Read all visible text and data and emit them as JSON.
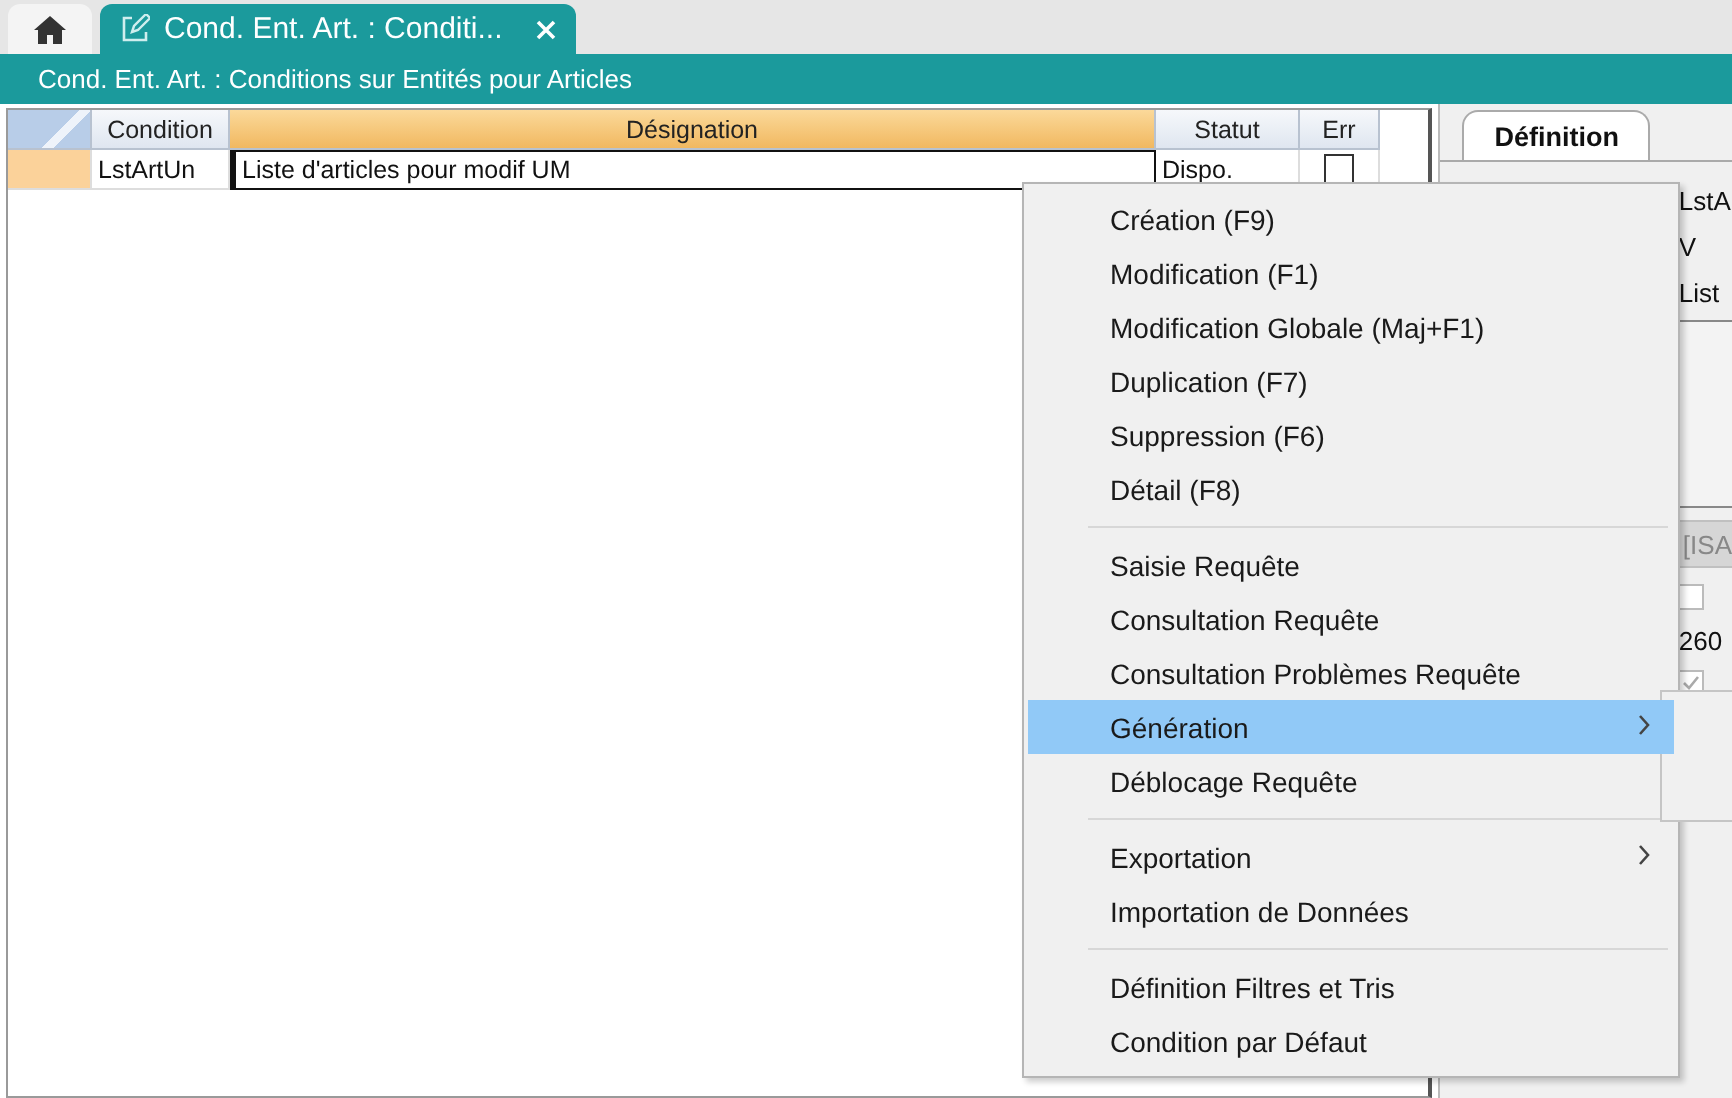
{
  "tabs": [
    {
      "kind": "home",
      "selected": false
    },
    {
      "kind": "document",
      "label": "Cond. Ent. Art. : Conditi...",
      "selected": true
    }
  ],
  "title_bar": {
    "title": "Cond. Ent. Art. : Conditions sur Entités pour Articles"
  },
  "grid": {
    "columns": [
      "Condition",
      "Désignation",
      "Statut",
      "Err"
    ],
    "rows": [
      {
        "selected": true,
        "condition": "LstArtUn",
        "designation": "Liste d'articles pour modif UM",
        "statut": "Dispo.",
        "err": false
      }
    ]
  },
  "side_panel": {
    "tab": "Définition",
    "code": "LstA",
    "version": "V",
    "label": "List",
    "field": "[ISA",
    "check_1": false,
    "number": "260",
    "check_2": true
  },
  "context_menu": {
    "items": [
      {
        "kind": "item",
        "label": "Création (F9)",
        "selected": false,
        "submenu": false
      },
      {
        "kind": "item",
        "label": "Modification (F1)",
        "selected": false,
        "submenu": false
      },
      {
        "kind": "item",
        "label": "Modification Globale (Maj+F1)",
        "selected": false,
        "submenu": false
      },
      {
        "kind": "item",
        "label": "Duplication (F7)",
        "selected": false,
        "submenu": false
      },
      {
        "kind": "item",
        "label": "Suppression (F6)",
        "selected": false,
        "submenu": false
      },
      {
        "kind": "item",
        "label": "Détail (F8)",
        "selected": false,
        "submenu": false
      },
      {
        "kind": "separator"
      },
      {
        "kind": "item",
        "label": "Saisie Requête",
        "selected": false,
        "submenu": false
      },
      {
        "kind": "item",
        "label": "Consultation Requête",
        "selected": false,
        "submenu": false
      },
      {
        "kind": "item",
        "label": "Consultation Problèmes Requête",
        "selected": false,
        "submenu": false
      },
      {
        "kind": "item",
        "label": "Génération",
        "selected": true,
        "submenu": true
      },
      {
        "kind": "item",
        "label": "Déblocage Requête",
        "selected": false,
        "submenu": false
      },
      {
        "kind": "separator"
      },
      {
        "kind": "item",
        "label": "Exportation",
        "selected": false,
        "submenu": true
      },
      {
        "kind": "item",
        "label": "Importation de Données",
        "selected": false,
        "submenu": false
      },
      {
        "kind": "separator"
      },
      {
        "kind": "item",
        "label": "Définition Filtres et Tris",
        "selected": false,
        "submenu": false
      },
      {
        "kind": "item",
        "label": "Condition par Défaut",
        "selected": false,
        "submenu": false
      }
    ]
  }
}
